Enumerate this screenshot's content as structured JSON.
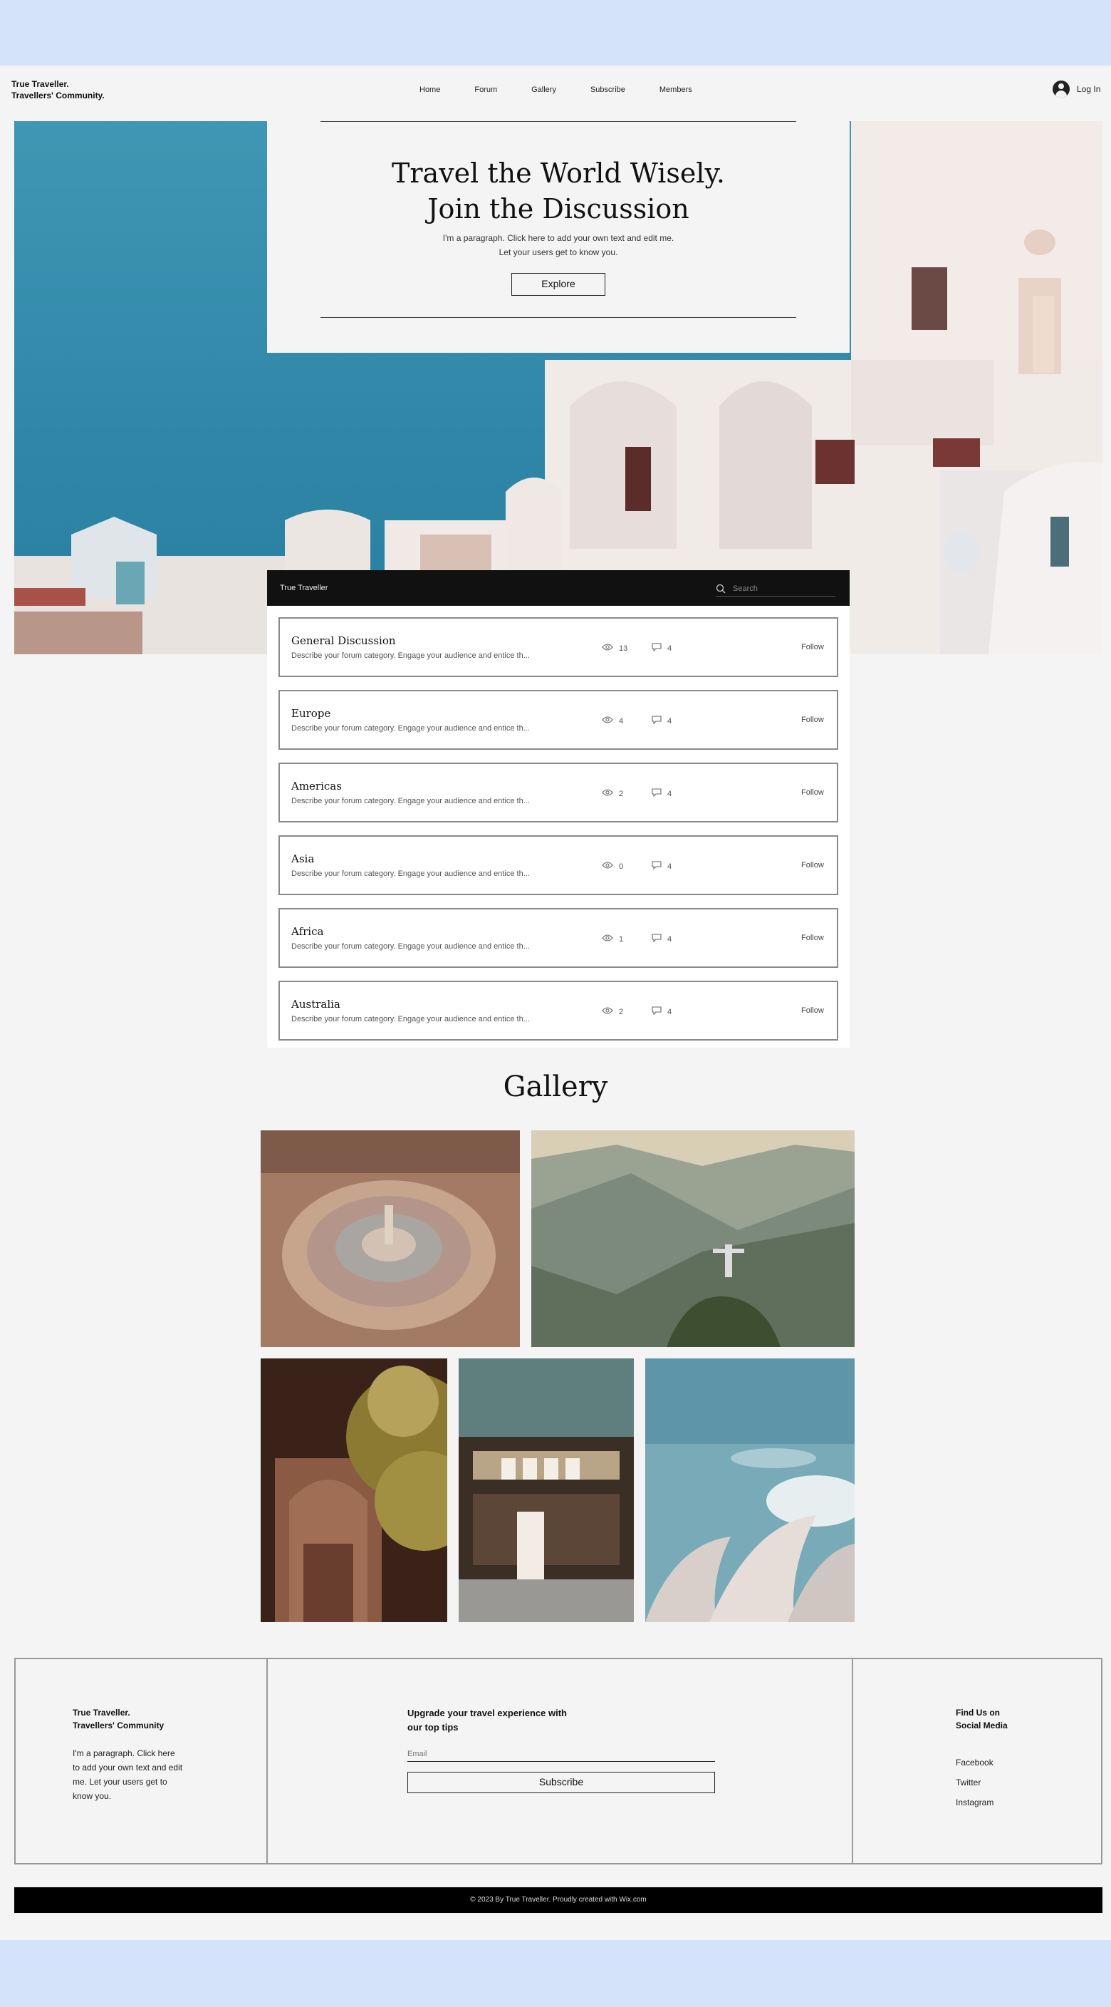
{
  "header": {
    "brand": "True Traveller.\nTravellers' Community.",
    "nav": [
      "Home",
      "Forum",
      "Gallery",
      "Subscribe",
      "Members"
    ],
    "login": "Log In"
  },
  "hero": {
    "title": "Travel the World Wisely.\nJoin the Discussion",
    "subtitle": "I'm a paragraph. Click here to add your own text and edit me.\nLet your users get to know you.",
    "button": "Explore"
  },
  "forum": {
    "title": "True Traveller",
    "search_placeholder": "Search",
    "follow_label": "Follow",
    "categories": [
      {
        "name": "General Discussion",
        "description": "Describe your forum category. Engage your audience and entice th...",
        "views": "13",
        "comments": "4"
      },
      {
        "name": "Europe",
        "description": "Describe your forum category. Engage your audience and entice th...",
        "views": "4",
        "comments": "4"
      },
      {
        "name": "Americas",
        "description": "Describe your forum category. Engage your audience and entice th...",
        "views": "2",
        "comments": "4"
      },
      {
        "name": "Asia",
        "description": "Describe your forum category. Engage your audience and entice th...",
        "views": "0",
        "comments": "4"
      },
      {
        "name": "Africa",
        "description": "Describe your forum category. Engage your audience and entice th...",
        "views": "1",
        "comments": "4"
      },
      {
        "name": "Australia",
        "description": "Describe your forum category. Engage your audience and entice th...",
        "views": "2",
        "comments": "4"
      }
    ]
  },
  "gallery": {
    "title": "Gallery",
    "images": [
      "fountain-plaza",
      "mountain-statue",
      "carved-arch",
      "japanese-shop",
      "opera-house-roof"
    ]
  },
  "footer": {
    "brand": "True Traveller.\nTravellers' Community",
    "paragraph": "I'm a paragraph. Click here\nto add your own text and edit\nme. Let your users get to\nknow you.",
    "upgrade": "Upgrade your travel experience with\nour top tips",
    "email_placeholder": "Email",
    "subscribe": "Subscribe",
    "find_us": "Find Us on\nSocial Media",
    "social": [
      "Facebook",
      "Twitter",
      "Instagram"
    ],
    "copyright": "© 2023 By True Traveller. Proudly created with Wix.com"
  },
  "colors": {
    "sea": "#3a8fab",
    "wall": "#f3ece8",
    "page": "#f4f4f4",
    "outer": "#d5e3fa",
    "bar": "#111111"
  }
}
